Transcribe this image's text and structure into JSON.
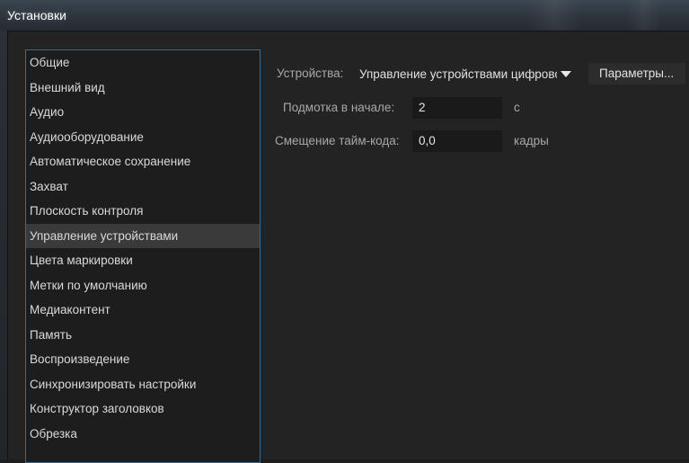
{
  "window": {
    "title": "Установки"
  },
  "sidebar": {
    "items": [
      {
        "label": "Общие"
      },
      {
        "label": "Внешний вид"
      },
      {
        "label": "Аудио"
      },
      {
        "label": "Аудиооборудование"
      },
      {
        "label": "Автоматическое сохранение"
      },
      {
        "label": "Захват"
      },
      {
        "label": "Плоскость контроля"
      },
      {
        "label": "Управление устройствами",
        "selected": true
      },
      {
        "label": "Цвета маркировки"
      },
      {
        "label": "Метки по умолчанию"
      },
      {
        "label": "Медиаконтент"
      },
      {
        "label": "Память"
      },
      {
        "label": "Воспроизведение"
      },
      {
        "label": "Синхронизировать настройки"
      },
      {
        "label": "Конструктор заголовков"
      },
      {
        "label": "Обрезка"
      }
    ]
  },
  "device": {
    "label": "Устройства:",
    "selected_value": "Управление устройствами цифрового видео",
    "params_button": "Параметры..."
  },
  "preroll": {
    "label": "Подмотка в начале:",
    "value": "2",
    "unit": "с"
  },
  "timecode_offset": {
    "label": "Смещение тайм-кода:",
    "value": "0,0",
    "unit": "кадры"
  },
  "colors": {
    "list_border": "#3a6a8c",
    "selected_row": "#3a3a3a",
    "panel_bg": "#232323"
  }
}
